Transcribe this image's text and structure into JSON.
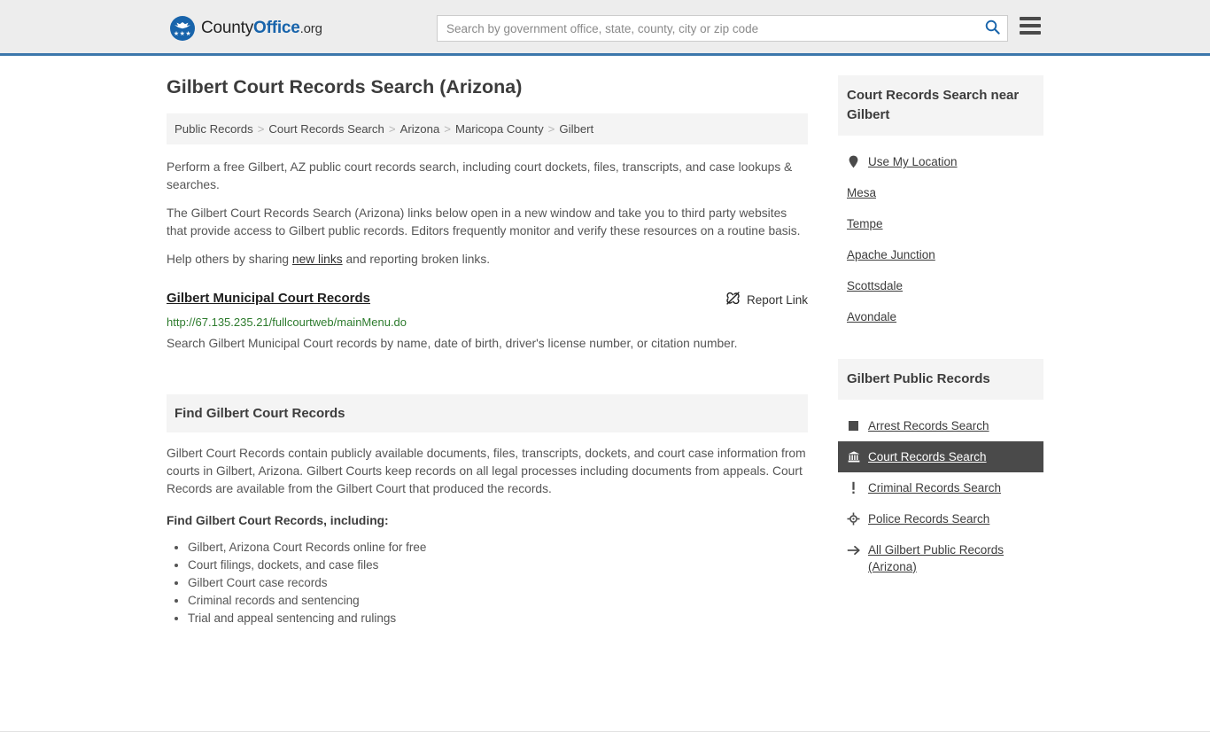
{
  "header": {
    "logo": {
      "text_primary": "County",
      "text_bold": "Office",
      "text_suffix": ".org",
      "icon": "eagle-emblem-icon"
    },
    "search": {
      "placeholder": "Search by government office, state, county, city or zip code",
      "value": "",
      "search_icon": "search-icon"
    },
    "menu_icon": "hamburger-menu-icon",
    "accent_color": "#3c77ab"
  },
  "page": {
    "title": "Gilbert Court Records Search (Arizona)",
    "breadcrumb": [
      "Public Records",
      "Court Records Search",
      "Arizona",
      "Maricopa County",
      "Gilbert"
    ],
    "breadcrumb_separator": ">",
    "intro_paragraphs": [
      "Perform a free Gilbert, AZ public court records search, including court dockets, files, transcripts, and case lookups & searches.",
      "The Gilbert Court Records Search (Arizona) links below open in a new window and take you to third party websites that provide access to Gilbert public records. Editors frequently monitor and verify these resources on a routine basis."
    ],
    "help_line": {
      "before": "Help others by sharing ",
      "link": "new links",
      "after": " and reporting broken links."
    }
  },
  "record": {
    "title": "Gilbert Municipal Court Records",
    "url": "http://67.135.235.21/fullcourtweb/mainMenu.do",
    "description": "Search Gilbert Municipal Court records by name, date of birth, driver's license number, or citation number.",
    "report_label": "Report Link",
    "report_icon": "broken-link-icon",
    "url_color": "#2d7b2d"
  },
  "find_section": {
    "heading": "Find Gilbert Court Records",
    "paragraph": "Gilbert Court Records contain publicly available documents, files, transcripts, dockets, and court case information from courts in Gilbert, Arizona. Gilbert Courts keep records on all legal processes including documents from appeals. Court Records are available from the Gilbert Court that produced the records.",
    "list_lead": "Find Gilbert Court Records, including:",
    "items": [
      "Gilbert, Arizona Court Records online for free",
      "Court filings, dockets, and case files",
      "Gilbert Court case records",
      "Criminal records and sentencing",
      "Trial and appeal sentencing and rulings"
    ]
  },
  "sidebar": {
    "nearby": {
      "heading": "Court Records Search near Gilbert",
      "items": [
        {
          "label": "Use My Location",
          "icon": "map-pin-icon",
          "highlight": false
        },
        {
          "label": "Mesa",
          "icon": "none",
          "highlight": false
        },
        {
          "label": "Tempe",
          "icon": "none",
          "highlight": false
        },
        {
          "label": "Apache Junction",
          "icon": "none",
          "highlight": false
        },
        {
          "label": "Scottsdale",
          "icon": "none",
          "highlight": false
        },
        {
          "label": "Avondale",
          "icon": "none",
          "highlight": false
        }
      ]
    },
    "public_records": {
      "heading": "Gilbert Public Records",
      "items": [
        {
          "label": "Arrest Records Search",
          "icon": "square-icon",
          "highlight": false
        },
        {
          "label": "Court Records Search",
          "icon": "courthouse-icon",
          "highlight": true
        },
        {
          "label": "Criminal Records Search",
          "icon": "exclamation-icon",
          "highlight": false
        },
        {
          "label": "Police Records Search",
          "icon": "police-badge-icon",
          "highlight": false
        },
        {
          "label": "All Gilbert Public Records (Arizona)",
          "icon": "arrow-right-icon",
          "highlight": false
        }
      ],
      "highlight_color": "#4a4a4a"
    }
  }
}
